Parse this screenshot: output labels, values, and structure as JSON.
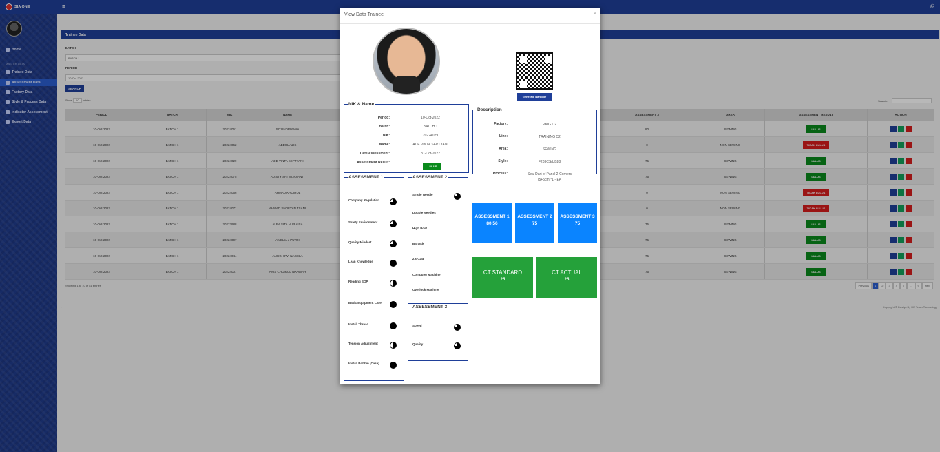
{
  "app": {
    "name": "SIA ONE"
  },
  "sidebar": {
    "section": "MASTER DATA",
    "items": [
      {
        "label": "Home"
      },
      {
        "label": "Trainee Data"
      },
      {
        "label": "Assessment Data"
      },
      {
        "label": "Factory Data"
      },
      {
        "label": "Style & Process Data"
      },
      {
        "label": "Indicator Assessment"
      },
      {
        "label": "Export Data"
      }
    ]
  },
  "page": {
    "panel_title": "Trainee Data",
    "batch_label": "BATCH",
    "batch_value": "BATCH 1",
    "period_label": "PERIOD",
    "period_value": "10-Oct-2022",
    "search_button": "SEARCH",
    "show_label": "Show",
    "show_value": "10",
    "entries_label": "entries",
    "search_label": "Search:",
    "showing_text": "Showing 1 to 10 of 81 entries",
    "copyright": "Copyright © Design By HE Team Technology"
  },
  "table": {
    "headers": [
      "PERIOD",
      "BATCH",
      "NIK",
      "NAME",
      "ASSESSMENT 3",
      "AREA",
      "ASSESSMENT RESULT",
      "ACTION"
    ],
    "rows": [
      {
        "period": "10-Oct-2022",
        "batch": "BATCH 1",
        "nik": "20224061",
        "name": "SITI INDRIYANA",
        "a3": "80",
        "area": "SEWING",
        "result": "LULUS",
        "ok": true
      },
      {
        "period": "10-Oct-2022",
        "batch": "BATCH 1",
        "nik": "20224062",
        "name": "ABDUL AZIS",
        "a3": "0",
        "area": "NON SEWING",
        "result": "TIDAK LULUS",
        "ok": false
      },
      {
        "period": "10-Oct-2022",
        "batch": "BATCH 1",
        "nik": "20224029",
        "name": "ADE VINTA SEPTYANI",
        "a3": "75",
        "area": "SEWING",
        "result": "LULUS",
        "ok": true
      },
      {
        "period": "10-Oct-2022",
        "batch": "BATCH 1",
        "nik": "20224075",
        "name": "ADISTY SRI WIJAYANTI",
        "a3": "75",
        "area": "SEWING",
        "result": "LULUS",
        "ok": true
      },
      {
        "period": "10-Oct-2022",
        "batch": "BATCH 1",
        "nik": "20224066",
        "name": "AHMAD KHOIRUL",
        "a3": "0",
        "area": "NON SEWING",
        "result": "TIDAK LULUS",
        "ok": false
      },
      {
        "period": "10-Oct-2022",
        "batch": "BATCH 1",
        "nik": "20224071",
        "name": "AHMAD SHOFYAN TSANI",
        "a3": "0",
        "area": "NON SEWING",
        "result": "TIDAK LULUS",
        "ok": false
      },
      {
        "period": "10-Oct-2022",
        "batch": "BATCH 1",
        "nik": "20223988",
        "name": "ALBA SITA NUR AISA",
        "a3": "75",
        "area": "SEWING",
        "result": "LULUS",
        "ok": true
      },
      {
        "period": "10-Oct-2022",
        "batch": "BATCH 1",
        "nik": "20224007",
        "name": "AMELIA J PUTRI",
        "a3": "75",
        "area": "SEWING",
        "result": "LULUS",
        "ok": true
      },
      {
        "period": "10-Oct-2022",
        "batch": "BATCH 1",
        "nik": "20224044",
        "name": "ANGGI DWI NAGELA",
        "a3": "75",
        "area": "SEWING",
        "result": "LULUS",
        "ok": true
      },
      {
        "period": "10-Oct-2022",
        "batch": "BATCH 1",
        "nik": "20224007",
        "name": "ANIS CHOIRUL NIKAMAH",
        "a3": "75",
        "area": "SEWING",
        "result": "LULUS",
        "ok": true
      }
    ]
  },
  "pagination": {
    "items": [
      "Previous",
      "1",
      "2",
      "3",
      "4",
      "5",
      "...",
      "9",
      "Next"
    ],
    "current": "1"
  },
  "modal": {
    "title": "View Data Trainee",
    "close": "×",
    "generate_button": "Generate Barcode",
    "nik_legend": "NIK & Name",
    "nik_fields": [
      {
        "k": "Period:",
        "v": "10-Oct-2022"
      },
      {
        "k": "Batch:",
        "v": "BATCH 1"
      },
      {
        "k": "NIK:",
        "v": "20224029"
      },
      {
        "k": "Name:",
        "v": "ADE VINTA SEPTYANI"
      },
      {
        "k": "Date Assessment:",
        "v": "31-Oct-2022"
      },
      {
        "k": "Assessment Result:",
        "v": "LULUS"
      }
    ],
    "desc_legend": "Description",
    "desc_fields": [
      {
        "k": "Factory:",
        "v": "PKIG C2"
      },
      {
        "k": "Line:",
        "v": "TRAINING C2"
      },
      {
        "k": "Area:",
        "v": "SEWING"
      },
      {
        "k": "Style:",
        "v": "F203CS/UB28"
      },
      {
        "k": "Process:",
        "v": "Sew Dart of Panel 2-Corners (5+5cm)*1 - EA"
      }
    ],
    "assessment1": {
      "legend": "ASSESSMENT 1",
      "items": [
        {
          "label": "Company Regulation",
          "level": 0.75
        },
        {
          "label": "Safety Environment",
          "level": 0.75
        },
        {
          "label": "Quality Mindset",
          "level": 0.75
        },
        {
          "label": "Lean Knowledge",
          "level": 1
        },
        {
          "label": "Reading SOP",
          "level": 0.5
        },
        {
          "label": "Basic Equipment Care",
          "level": 1
        },
        {
          "label": "Install Thread",
          "level": 1
        },
        {
          "label": "Tension Adjustment",
          "level": 0.5
        },
        {
          "label": "Install Bobbin (Case)",
          "level": 1
        }
      ]
    },
    "assessment2": {
      "legend": "ASSESSMENT 2",
      "items": [
        {
          "label": "Single Needle",
          "level": 0.75
        },
        {
          "label": "Double Needles",
          "level": null
        },
        {
          "label": "High Post",
          "level": null
        },
        {
          "label": "Bartack",
          "level": null
        },
        {
          "label": "Zig-Zag",
          "level": null
        },
        {
          "label": "Computer Machine",
          "level": null
        },
        {
          "label": "Overlock Machine",
          "level": null
        }
      ]
    },
    "assessment3": {
      "legend": "ASSESSMENT 3",
      "items": [
        {
          "label": "Speed",
          "level": 0.75
        },
        {
          "label": "Quality",
          "level": 0.75
        }
      ]
    },
    "scores": [
      {
        "label": "ASSESSMENT 1",
        "value": "80.56"
      },
      {
        "label": "ASSESSMENT 2",
        "value": "75"
      },
      {
        "label": "ASSESSMENT 3",
        "value": "75"
      }
    ],
    "ct": [
      {
        "label": "CT STANDARD",
        "value": "25"
      },
      {
        "label": "CT ACTUAL",
        "value": "25"
      }
    ],
    "colors": {
      "primary": "#1f3f99",
      "success": "#0a8a1c",
      "danger": "#d61c1c",
      "score_blue": "#0a84ff",
      "ct_green": "#25a13a"
    }
  }
}
